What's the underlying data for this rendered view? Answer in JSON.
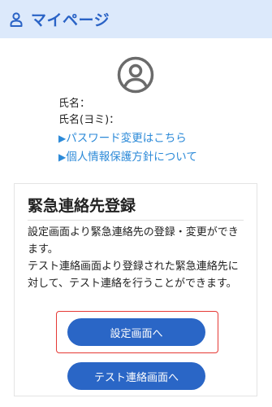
{
  "header": {
    "icon": "user-icon",
    "title": "マイページ",
    "background": "#dce9fb",
    "accent": "#2a63c6"
  },
  "profile": {
    "avatar_icon": "user-circle-icon",
    "name_label": "氏名：",
    "name_value": "",
    "kana_label": "氏名(ヨミ)：",
    "kana_value": "",
    "links": {
      "password_arrow": "▶",
      "password_label": "パスワード変更はこちら",
      "policy_arrow": "▶",
      "policy_label": "個人情報保護方針について"
    },
    "link_color": "#2c8ad8"
  },
  "emergency": {
    "title": "緊急連絡先登録",
    "description_1": "設定画面より緊急連絡先の登録・変更ができます。",
    "description_2": "テスト連絡画面より登録された緊急連絡先に対して、テスト連絡を行うことができます。",
    "settings_button": "設定画面へ",
    "test_button": "テスト連絡画面へ",
    "button_color": "#2a66c6",
    "highlight_color": "#e53935"
  }
}
